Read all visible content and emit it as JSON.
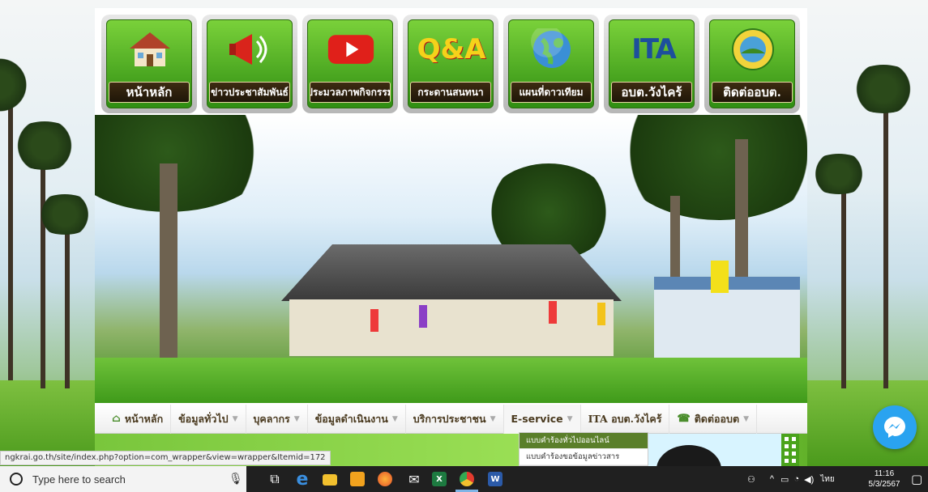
{
  "top_buttons": [
    {
      "label": "หน้าหลัก",
      "icon": "house-icon"
    },
    {
      "label": "ข่าวประชาสัมพันธ์",
      "icon": "megaphone-icon"
    },
    {
      "label": "ประมวลภาพกิจกรรม",
      "icon": "youtube-play-icon"
    },
    {
      "label": "กระดานสนทนา",
      "icon": "qa-icon"
    },
    {
      "label": "แผนที่ดาวเทียม",
      "icon": "globe-icon"
    },
    {
      "label": "อบต.วังไคร้",
      "icon": "ita-icon"
    },
    {
      "label": "ติดต่ออบต.",
      "icon": "seal-icon"
    }
  ],
  "tile_texts": {
    "qa": "Q&A",
    "ita": "ITA"
  },
  "nav": {
    "items": [
      {
        "label": "หน้าหลัก",
        "has_caret": false,
        "icon": "home-icon"
      },
      {
        "label": "ข้อมูลทั่วไป",
        "has_caret": true
      },
      {
        "label": "บุคลากร",
        "has_caret": true
      },
      {
        "label": "ข้อมูลดำเนินงาน",
        "has_caret": true
      },
      {
        "label": "บริการประชาชน",
        "has_caret": true
      },
      {
        "label": "E-service",
        "has_caret": true
      },
      {
        "label": "ITA อบต.วังไคร้",
        "has_caret": false
      },
      {
        "label": "ติดต่ออบต",
        "has_caret": true,
        "icon": "phone-icon"
      }
    ]
  },
  "dropdown": {
    "items": [
      "แบบคำร้องทั่วไปออนไลน์",
      "แบบคำร้องขอข้อมูลข่าวสาร"
    ]
  },
  "status_url": "ngkrai.go.th/site/index.php?option=com_wrapper&view=wrapper&Itemid=172",
  "taskbar": {
    "search_placeholder": "Type here to search",
    "language": "ไทย",
    "time": "11:16",
    "date": "5/3/2567"
  },
  "colors": {
    "tile_green": "#2f8e12",
    "label_dark": "#1f1608",
    "messenger_blue": "#2aa3f0",
    "taskbar": "#202020"
  }
}
